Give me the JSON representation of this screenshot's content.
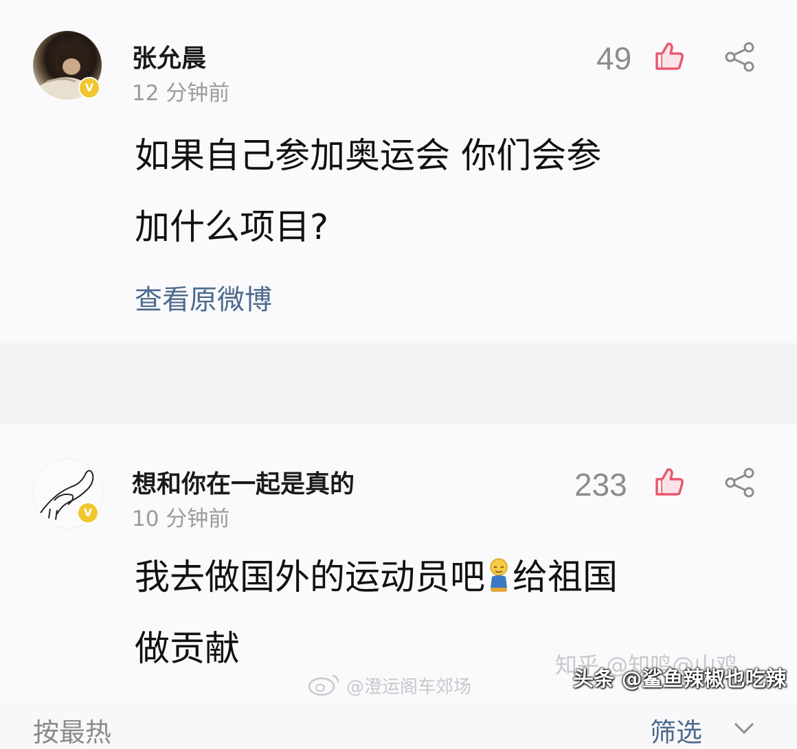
{
  "post": {
    "username": "张允晨",
    "timestamp": "12 分钟前",
    "likes": "49",
    "content_lines": [
      "如果自己参加奥运会 你们会参",
      "加什么项目?"
    ],
    "view_original": "查看原微博",
    "verified_badge": "V"
  },
  "filter_bar": {
    "sort": "按最热",
    "filter": "筛选"
  },
  "comment": {
    "username": "想和你在一起是真的",
    "timestamp": "10 分钟前",
    "likes": "233",
    "content_line1_before_emoji": "我去做国外的运动员吧",
    "content_line1_after_emoji": "给祖国",
    "content_line2": "做贡献",
    "verified_badge": "V"
  },
  "watermarks": {
    "zhihu": "知乎 @知鸣@山鸡",
    "weibo": "@澄运阁车郊场",
    "toutiao": "头条 @鲨鱼辣椒也吃辣"
  },
  "colors": {
    "like_icon": "#e8596e",
    "link_blue": "#4d6a8c",
    "verified_gold": "#f0c62e"
  }
}
